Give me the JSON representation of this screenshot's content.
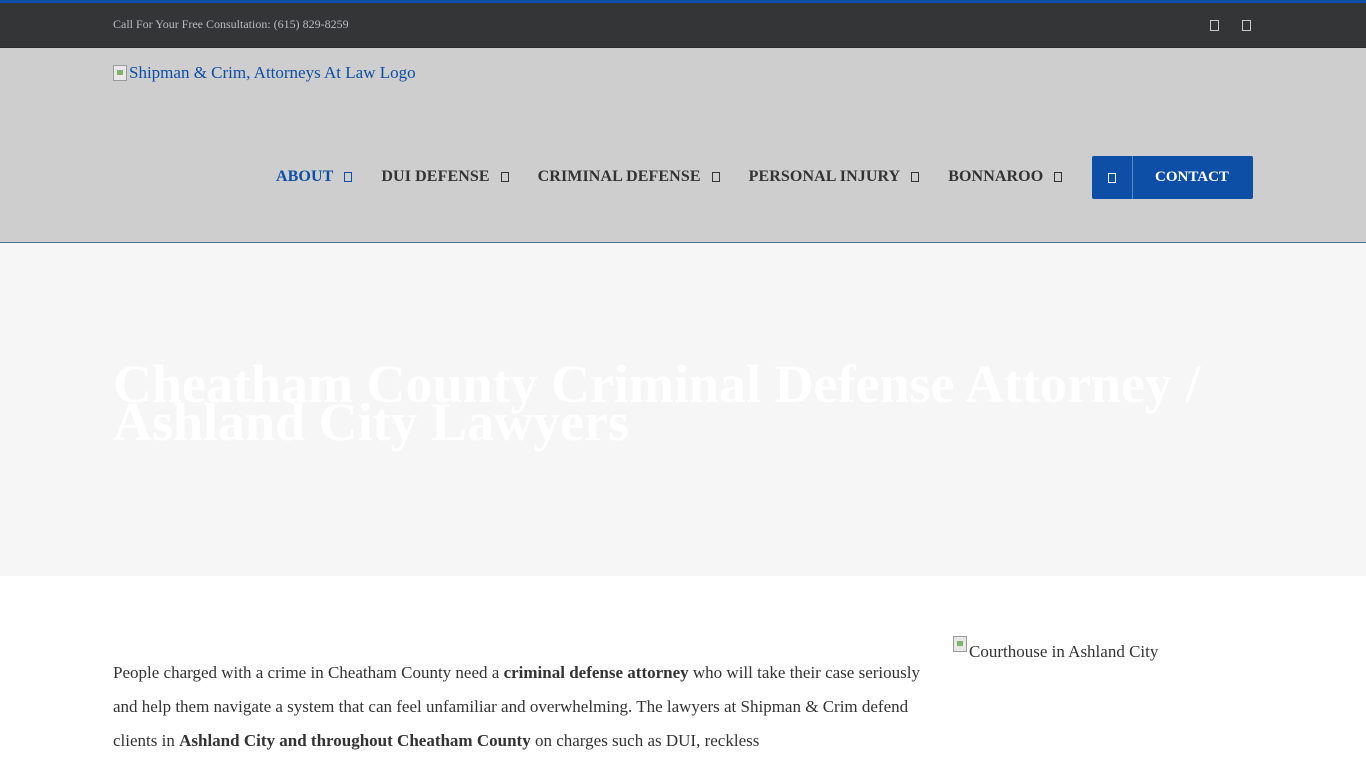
{
  "topbar": {
    "phone_text": "Call For Your Free Consultation: (615) 829-8259",
    "social_icons": [
      "facebook-icon",
      "twitter-icon"
    ]
  },
  "header": {
    "logo_alt": "Shipman & Crim, Attorneys At Law Logo",
    "nav": [
      {
        "label": "ABOUT",
        "active": true
      },
      {
        "label": "DUI DEFENSE",
        "active": false
      },
      {
        "label": "CRIMINAL DEFENSE",
        "active": false
      },
      {
        "label": "PERSONAL INJURY",
        "active": false
      },
      {
        "label": "BONNAROO",
        "active": false
      }
    ],
    "contact_label": "CONTACT",
    "contact_icon": "phone-icon"
  },
  "hero": {
    "title_line1": "Cheatham County Criminal Defense Attorney /",
    "title_line2": "Ashland City Lawyers"
  },
  "content": {
    "p1_a": "People charged with a crime in Cheatham County need a ",
    "p1_b": "criminal defense attorney",
    "p1_c": " who will take their case seriously and help them navigate a system that can feel unfamiliar and overwhelming. The lawyers at Shipman & Crim defend clients in ",
    "p1_d": "Ashland City and throughout Cheatham County",
    "p1_e": " on charges such as DUI, reckless"
  },
  "sidebar": {
    "image_alt": "Courthouse in Ashland City"
  },
  "colors": {
    "accent": "#0d4ea6",
    "topbar_bg": "#333537",
    "header_bg": "#cecece",
    "hero_bg": "#f6f6f6"
  }
}
